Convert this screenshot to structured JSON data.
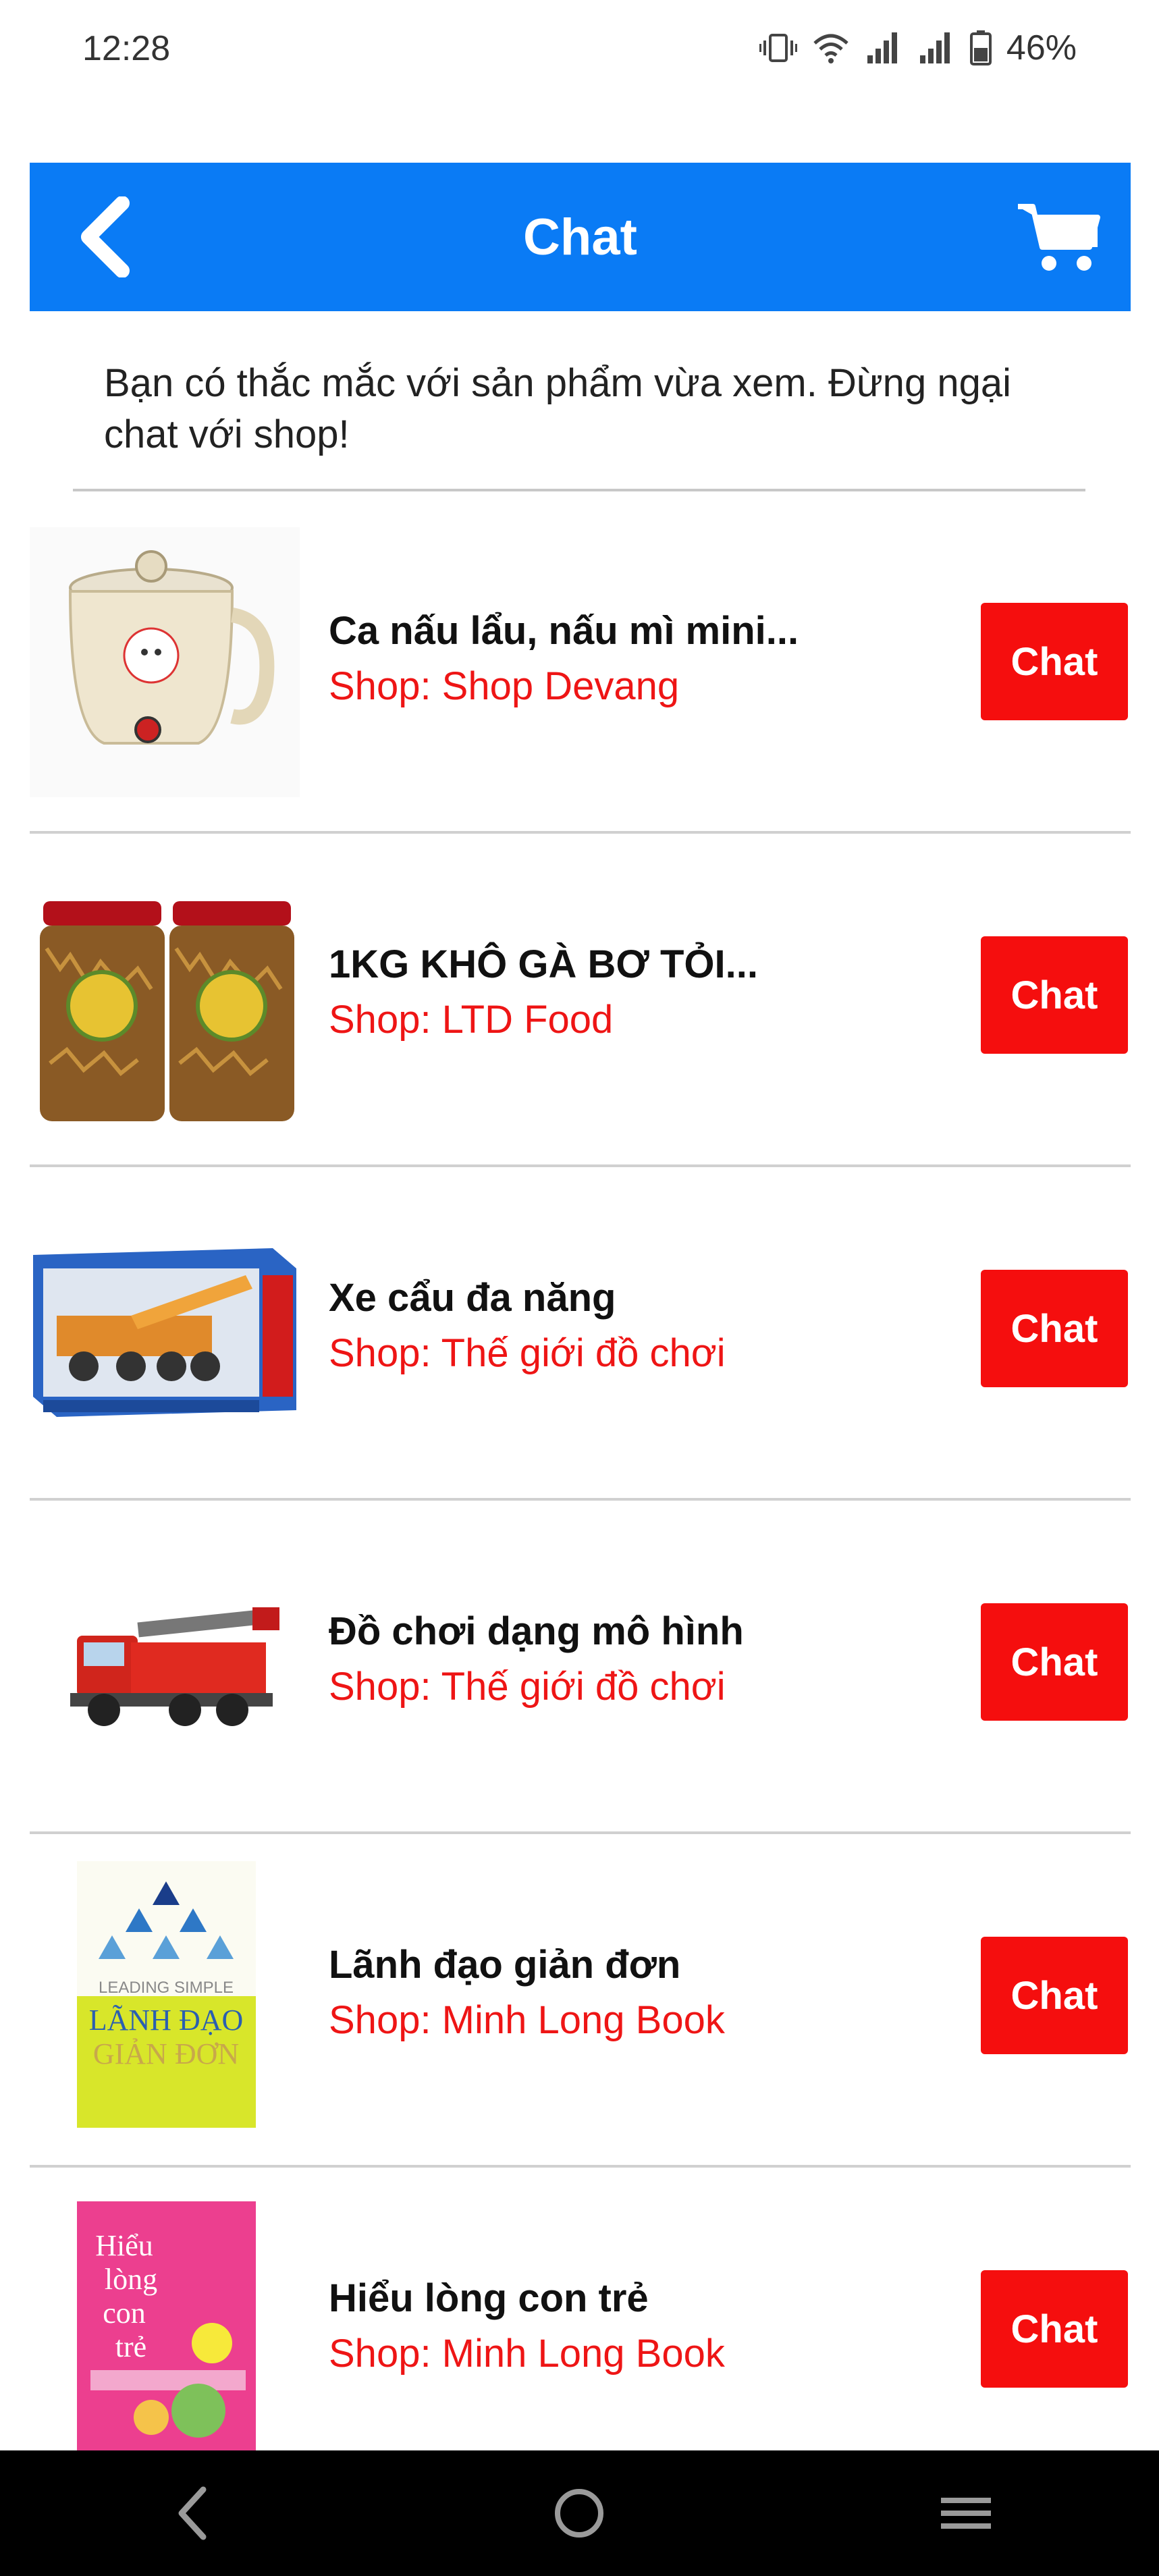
{
  "status_bar": {
    "time": "12:28",
    "battery": "46%"
  },
  "header": {
    "title": "Chat",
    "back_icon": "chevron-left-icon",
    "cart_icon": "cart-icon",
    "color": "#0a7bf5"
  },
  "intro_text": "Bạn có thắc mắc với sản phẩm vừa xem. Đừng ngại chat với shop!",
  "items": [
    {
      "name": "Ca nấu lẩu, nấu mì mini...",
      "shop": "Shop: Shop Devang",
      "chat_label": "Chat",
      "thumb": "electric-pot"
    },
    {
      "name": "1KG KHÔ GÀ BƠ TỎI...",
      "shop": "Shop: LTD Food",
      "chat_label": "Chat",
      "thumb": "food-jars"
    },
    {
      "name": "Xe cẩu đa năng",
      "shop": "Shop: Thế giới đồ chơi",
      "chat_label": "Chat",
      "thumb": "crane-toy-box"
    },
    {
      "name": "Đồ chơi dạng mô hình",
      "shop": "Shop: Thế giới đồ chơi",
      "chat_label": "Chat",
      "thumb": "fire-truck-toy"
    },
    {
      "name": "Lãnh đạo giản đơn",
      "shop": "Shop: Minh Long Book",
      "chat_label": "Chat",
      "thumb": "book-leadership"
    },
    {
      "name": "Hiểu lòng con trẻ",
      "shop": "Shop: Minh Long Book",
      "chat_label": "Chat",
      "thumb": "book-children"
    }
  ],
  "book_covers": {
    "leadership": {
      "top": "LEADING SIMPLE",
      "line1": "LÃNH ĐẠO",
      "line2": "GIẢN ĐƠN"
    },
    "children": {
      "line1": "Hiểu",
      "line2": "lòng",
      "line3": "con",
      "line4": "trẻ"
    }
  },
  "nav": {
    "back_icon": "nav-back-icon",
    "home_icon": "nav-home-icon",
    "menu_icon": "nav-menu-icon"
  },
  "colors": {
    "accent": "#0a7bf5",
    "chat_button": "#f50e0e",
    "shop_text": "#ee1515"
  }
}
